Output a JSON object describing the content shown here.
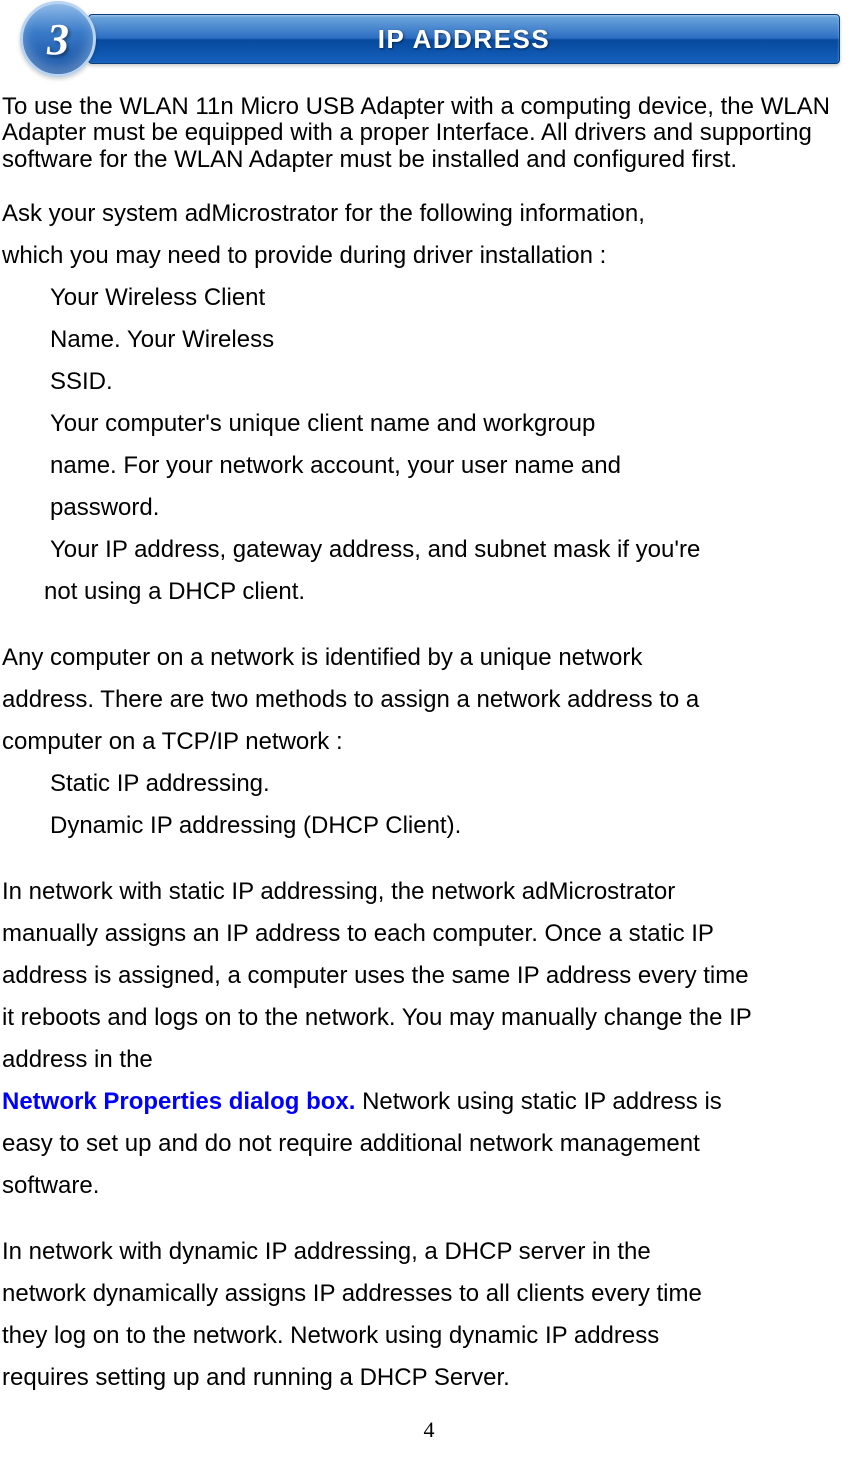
{
  "header": {
    "step_number": "3",
    "title": "IP ADDRESS"
  },
  "intro": "To use the WLAN 11n Micro USB Adapter with a computing device, the WLAN Adapter must be equipped with a proper Interface. All drivers and supporting software for the WLAN Adapter must be installed and configured first.",
  "ask_line1": "Ask your system adMicrostrator for the following information,",
  "ask_line2": "which you may need to provide during driver installation :",
  "needs": {
    "l1": "Your Wireless Client",
    "l2": "Name. Your Wireless",
    "l3": "SSID.",
    "l4": "Your computer's unique client name and workgroup",
    "l5": "name. For your network account, your user name and",
    "l6": "password.",
    "l7": "Your IP address, gateway address, and subnet mask if you're",
    "l8": "not using a DHCP client."
  },
  "para2": {
    "l1": "Any computer on a network is identified by a unique network",
    "l2": "address. There are two methods to assign a network address to a",
    "l3": "computer on a TCP/IP network :"
  },
  "methods": {
    "l1": "Static IP addressing.",
    "l2": "Dynamic IP addressing (DHCP Client)."
  },
  "static_para": {
    "l1": "In network with static IP addressing, the network adMicrostrator",
    "l2": "manually assigns an IP address to each computer. Once a static IP",
    "l3": "address is assigned, a computer uses the same IP address every time",
    "l4": "it reboots and logs on to the network. You may manually change the IP",
    "l5": "address in the",
    "highlight": "Network Properties dialog box.",
    "l6_rest": " Network using static IP address is",
    "l7": "easy to set up and do not require additional network management",
    "l8": "software."
  },
  "dynamic_para": {
    "l1": "In network with dynamic IP addressing, a DHCP server in the",
    "l2": "network dynamically assigns IP addresses to all clients every time",
    "l3": "they log on to the network. Network using dynamic IP address",
    "l4": "requires setting up and running a DHCP Server."
  },
  "page_number": "4"
}
